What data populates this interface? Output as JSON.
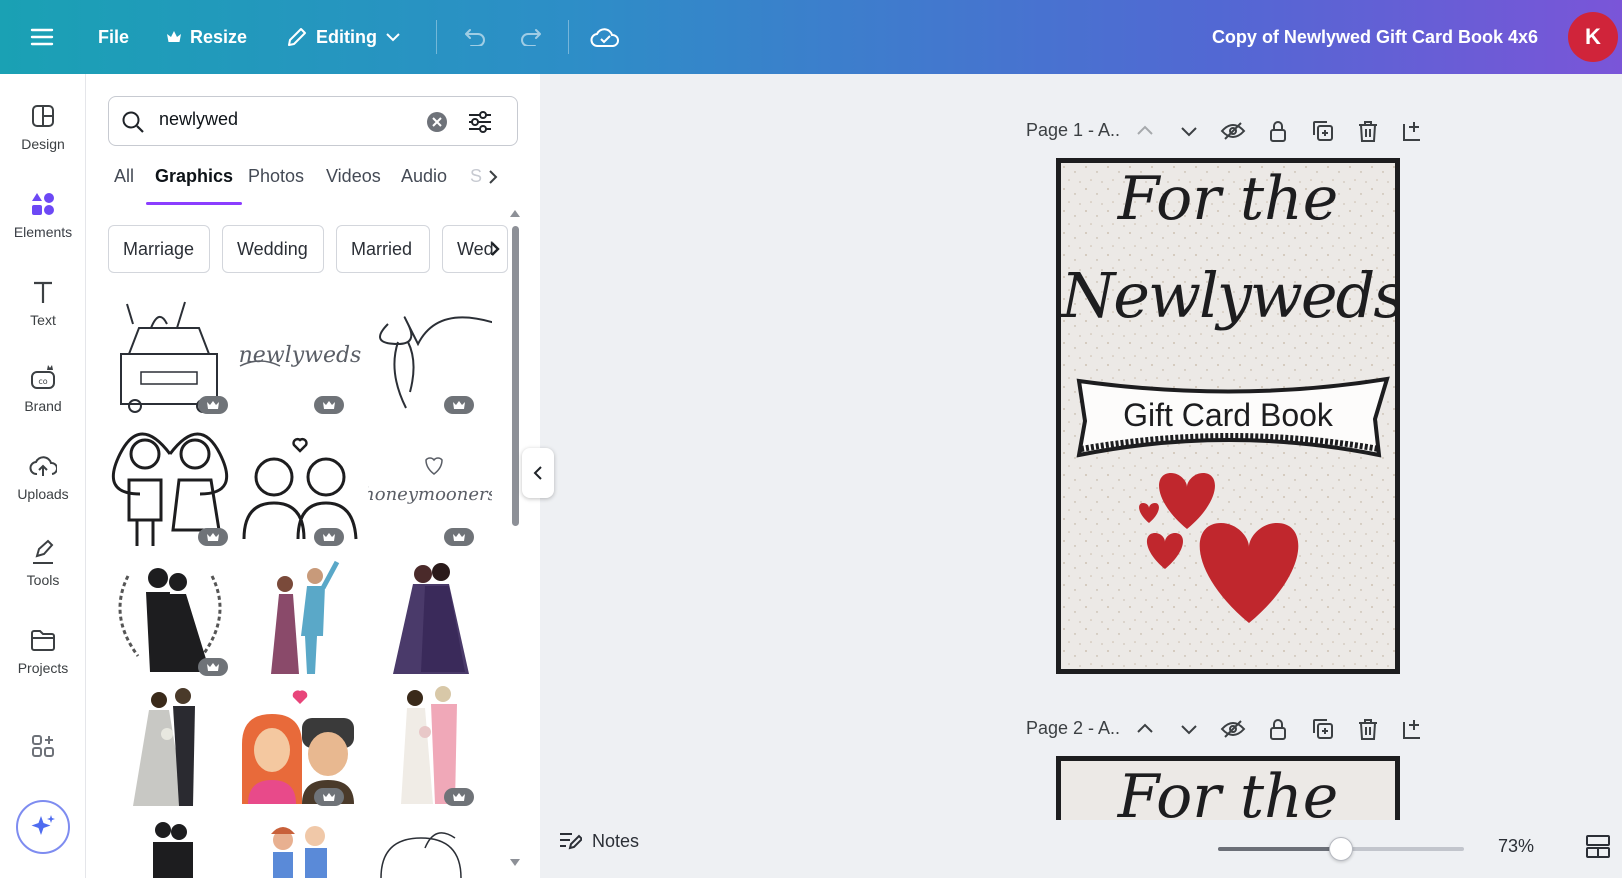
{
  "topbar": {
    "file_label": "File",
    "resize_label": "Resize",
    "mode_label": "Editing",
    "document_title": "Copy of Newlywed Gift Card Book 4x6",
    "avatar_initial": "K"
  },
  "rail": {
    "items": [
      {
        "label": "Design",
        "icon": "layout-icon"
      },
      {
        "label": "Elements",
        "icon": "shapes-icon"
      },
      {
        "label": "Text",
        "icon": "text-icon"
      },
      {
        "label": "Brand",
        "icon": "brand-icon"
      },
      {
        "label": "Uploads",
        "icon": "cloud-upload-icon"
      },
      {
        "label": "Tools",
        "icon": "pen-icon"
      },
      {
        "label": "Projects",
        "icon": "folder-icon"
      }
    ],
    "active": "Elements"
  },
  "panel": {
    "search_value": "newlywed",
    "tabs": [
      "All",
      "Graphics",
      "Photos",
      "Videos",
      "Audio",
      "S"
    ],
    "active_tab": "Graphics",
    "chips": [
      "Marriage",
      "Wedding",
      "Married",
      "Wed"
    ]
  },
  "pages": [
    {
      "label": "Page 1 - A.."
    },
    {
      "label": "Page 2 - A.."
    }
  ],
  "card": {
    "line1": "For the",
    "line2": "Newlyweds",
    "banner": "Gift Card Book"
  },
  "bottombar": {
    "notes_label": "Notes",
    "zoom": "73%",
    "zoom_fraction": 0.5
  },
  "colors": {
    "accent": "#8b3dff",
    "heart": "#c0272d",
    "avatar": "#d0243a"
  }
}
